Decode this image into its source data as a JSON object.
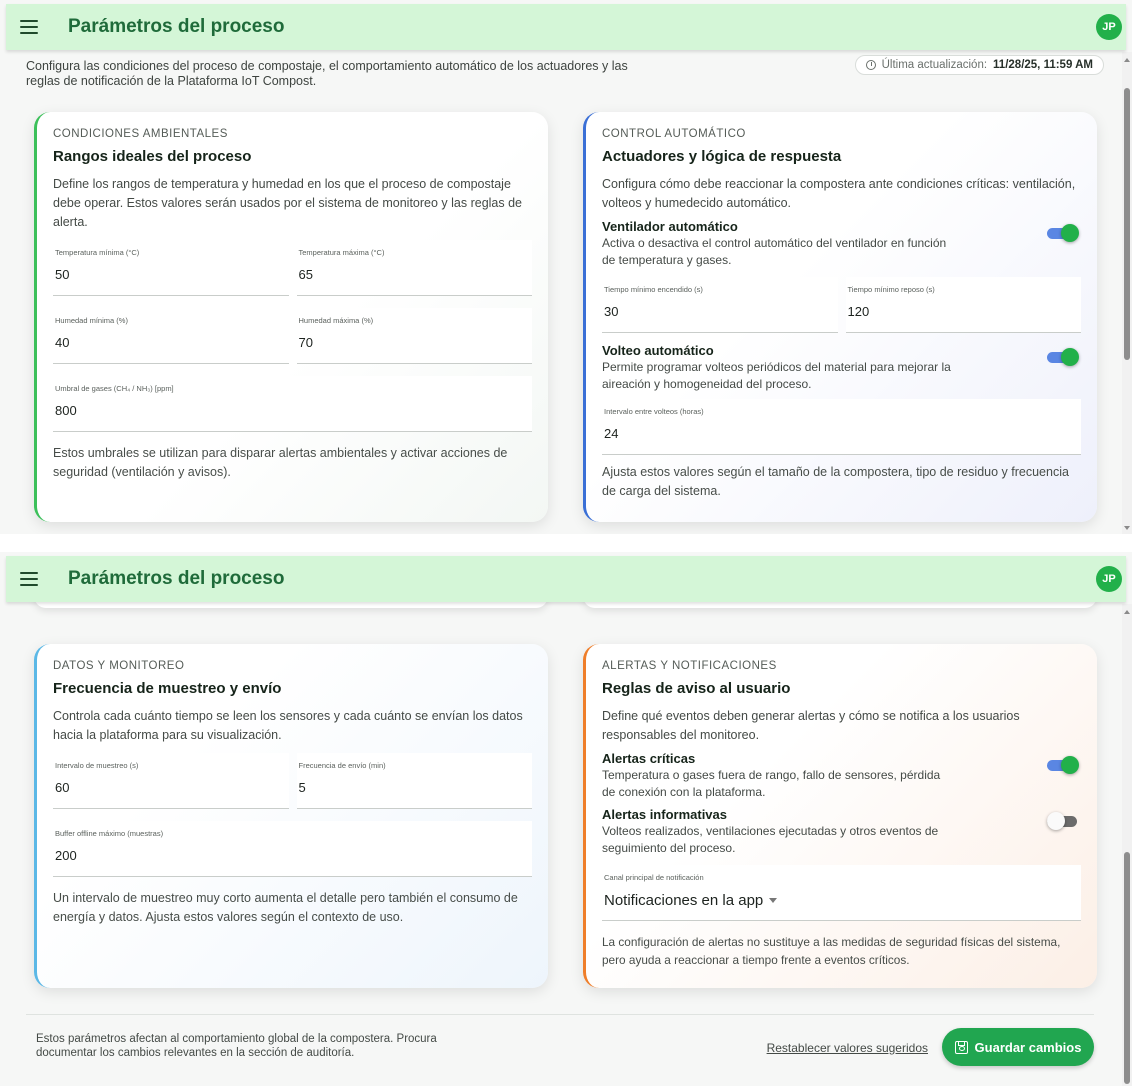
{
  "app": {
    "title": "Parámetros del proceso",
    "avatar_initials": "JP",
    "accent_color": "#22b04a",
    "appbar_color": "#d4f6d7"
  },
  "intro": {
    "text": "Configura las condiciones del proceso de compostaje, el comportamiento automático de los actuadores y las reglas de notificación de la Plataforma IoT Compost.",
    "updated_label": "Última actualización:",
    "updated_value": "11/28/25, 11:59 AM"
  },
  "env": {
    "eyebrow": "CONDICIONES AMBIENTALES",
    "title": "Rangos ideales del proceso",
    "desc": "Define los rangos de temperatura y humedad en los que el proceso de compostaje debe operar. Estos valores serán usados por el sistema de monitoreo y las reglas de alerta.",
    "temp_min_label": "Temperatura mínima (°C)",
    "temp_min": "50",
    "temp_max_label": "Temperatura máxima (°C)",
    "temp_max": "65",
    "hum_min_label": "Humedad mínima (%)",
    "hum_min": "40",
    "hum_max_label": "Humedad máxima (%)",
    "hum_max": "70",
    "gas_label": "Umbral de gases (CH₄ / NH₃) [ppm]",
    "gas": "800",
    "note": "Estos umbrales se utilizan para disparar alertas ambientales y activar acciones de seguridad (ventilación y avisos)."
  },
  "control": {
    "eyebrow": "CONTROL AUTOMÁTICO",
    "title": "Actuadores y lógica de respuesta",
    "desc": "Configura cómo debe reaccionar la compostera ante condiciones críticas: ventilación, volteos y humedecido automático.",
    "fan_title": "Ventilador automático",
    "fan_desc": "Activa o desactiva el control automático del ventilador en función de temperatura y gases.",
    "fan_on": true,
    "fan_min_on_label": "Tiempo mínimo encendido (s)",
    "fan_min_on": "30",
    "fan_min_rest_label": "Tiempo mínimo reposo (s)",
    "fan_min_rest": "120",
    "turn_title": "Volteo automático",
    "turn_desc": "Permite programar volteos periódicos del material para mejorar la aireación y homogeneidad del proceso.",
    "turn_on": true,
    "turn_interval_label": "Intervalo entre volteos (horas)",
    "turn_interval": "24",
    "note": "Ajusta estos valores según el tamaño de la compostera, tipo de residuo y frecuencia de carga del sistema."
  },
  "data": {
    "eyebrow": "DATOS Y MONITOREO",
    "title": "Frecuencia de muestreo y envío",
    "desc": "Controla cada cuánto tiempo se leen los sensores y cada cuánto se envían los datos hacia la plataforma para su visualización.",
    "sample_label": "Intervalo de muestreo (s)",
    "sample": "60",
    "send_label": "Frecuencia de envío (min)",
    "send": "5",
    "buffer_label": "Buffer offline máximo (muestras)",
    "buffer": "200",
    "note": "Un intervalo de muestreo muy corto aumenta el detalle pero también el consumo de energía y datos. Ajusta estos valores según el contexto de uso."
  },
  "alerts": {
    "eyebrow": "ALERTAS Y NOTIFICACIONES",
    "title": "Reglas de aviso al usuario",
    "desc": "Define qué eventos deben generar alertas y cómo se notifica a los usuarios responsables del monitoreo.",
    "critical_title": "Alertas críticas",
    "critical_desc": "Temperatura o gases fuera de rango, fallo de sensores, pérdida de conexión con la plataforma.",
    "critical_on": true,
    "info_title": "Alertas informativas",
    "info_desc": "Volteos realizados, ventilaciones ejecutadas y otros eventos de seguimiento del proceso.",
    "info_on": false,
    "channel_label": "Canal principal de notificación",
    "channel": "Notificaciones en la app",
    "note": "La configuración de alertas no sustituye a las medidas de seguridad físicas del sistema, pero ayuda a reaccionar a tiempo frente a eventos críticos."
  },
  "footer": {
    "text": "Estos parámetros afectan al comportamiento global de la compostera. Procura documentar los cambios relevantes en la sección de auditoría.",
    "reset_label": "Restablecer valores sugeridos",
    "save_label": "Guardar cambios"
  }
}
